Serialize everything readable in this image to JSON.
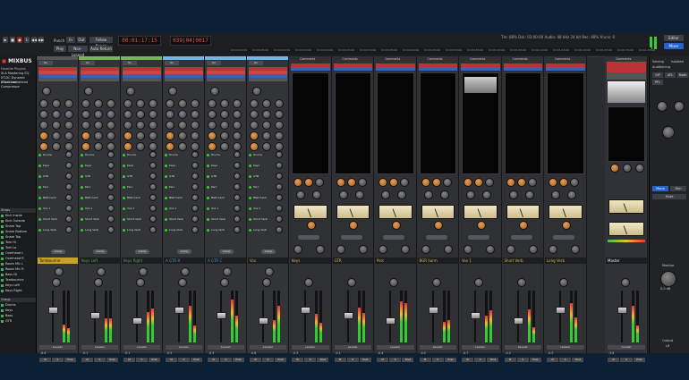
{
  "transport": {
    "punch_label": "Punch",
    "in_label": "In",
    "out_label": "Out",
    "follow_range": "Follow Range",
    "play_label": "Play",
    "nonlooped": "Non-Looped",
    "auto_return": "Auto Return",
    "tc_primary": "00:01:17:15",
    "tc_secondary": "039|04|0017",
    "status_line": "Tm: 88%  Dsk: 03:00:00  Audio: 48 kHz 24 bit  Rec: 48%  Xruns: 0",
    "editor_label": "Editor",
    "mixer_label": "Mixer"
  },
  "ruler": {
    "ticks": [
      "00:00:00:00",
      "00:00:05:00",
      "00:00:10:00",
      "00:00:15:00",
      "00:00:20:00",
      "00:00:25:00",
      "00:00:30:00",
      "00:00:35:00",
      "00:00:40:00",
      "00:00:45:00",
      "00:00:50:00",
      "00:00:55:00",
      "00:01:00:00",
      "00:01:05:00",
      "00:01:10:00",
      "00:01:15:00",
      "00:01:20:00",
      "00:01:25:00",
      "00:01:30:00",
      "00:01:35:00"
    ]
  },
  "left_panel": {
    "logo": "MIXBUS",
    "favorites_title": "Favorite Plugins",
    "favorites": [
      "XLA Mastering EQ",
      "XT-DC Dynamic Character",
      "XT-LC Lookahead Compressor"
    ],
    "strips_title": "Strips",
    "strips": [
      "Kick Inside",
      "Kick Outside",
      "Snare Top",
      "Snare Bottom",
      "Snare Top",
      "Tom Hi",
      "Tom Lo",
      "Overhead L",
      "Overhead R",
      "Room Mic L",
      "Room Mic R",
      "Bass DI",
      "Tambourine",
      "Keys Left",
      "Keys Right"
    ],
    "groups_title": "Group",
    "groups": [
      "Drums",
      "Keys",
      "Bass",
      "GTR"
    ]
  },
  "groups_bar": {
    "keys": "Keys",
    "gtr": "GTR"
  },
  "tracks": [
    {
      "name": "Tambourine",
      "color": "#c9a227",
      "fader": "-0.4",
      "pan": "L"
    },
    {
      "name": "Keys Left",
      "color": "#5aa84a",
      "fader": "-0.1",
      "pan": "L"
    },
    {
      "name": "Keys Right",
      "color": "#5aa84a",
      "fader": "-0.1",
      "pan": "R"
    },
    {
      "name": "A GTR R",
      "color": "#4a90c8",
      "fader": "-0.5",
      "pan": "R"
    },
    {
      "name": "A GTR C",
      "color": "#4a90c8",
      "fader": "-0.3",
      "pan": "C"
    },
    {
      "name": "Vox",
      "color": "#c8a64a",
      "fader": "-0.6",
      "pan": "C"
    }
  ],
  "buses": [
    {
      "name": "Keys",
      "fader": "-0.3"
    },
    {
      "name": "GTR",
      "fader": "-0.1"
    },
    {
      "name": "Perc",
      "fader": "-0.4"
    },
    {
      "name": "BGR harm",
      "fader": "-0.2"
    },
    {
      "name": "Vox 1",
      "fader": "-0.7"
    },
    {
      "name": "Short Verb",
      "fader": "-0.2"
    },
    {
      "name": "Long Verb",
      "fader": "-0.3"
    }
  ],
  "master": {
    "name": "Master",
    "fader": "-3.6",
    "comments": "Comments"
  },
  "send_labels": [
    "Drums",
    "Keys",
    "GTR",
    "Perc",
    "BGR harm",
    "Vox 1",
    "Short Verb",
    "Long Verb"
  ],
  "strip_buttons": {
    "mute": "M",
    "solo": "S",
    "comp": "Comp",
    "leveler": "Leveler",
    "iso": "Iso",
    "lock": "Lock",
    "post": "Post",
    "comments": "Comments"
  },
  "right_panel": {
    "soloing": "Soloing",
    "isolated": "Isolated",
    "auditioning": "Auditioning",
    "sip": "SiP",
    "afl": "AFL",
    "rude": "Rude",
    "pfl": "PFL",
    "mute_button": "Mute",
    "mono": "Mono",
    "monitor_title": "Monitor",
    "monitor_value": "0.0 dB",
    "output_label": "Output",
    "output_value": "LR"
  },
  "colors": {
    "keys_group": "#7ab55c",
    "gtr_group": "#6fb8e8",
    "accent_red": "#e7574b",
    "selected_blue": "#2563c8"
  }
}
